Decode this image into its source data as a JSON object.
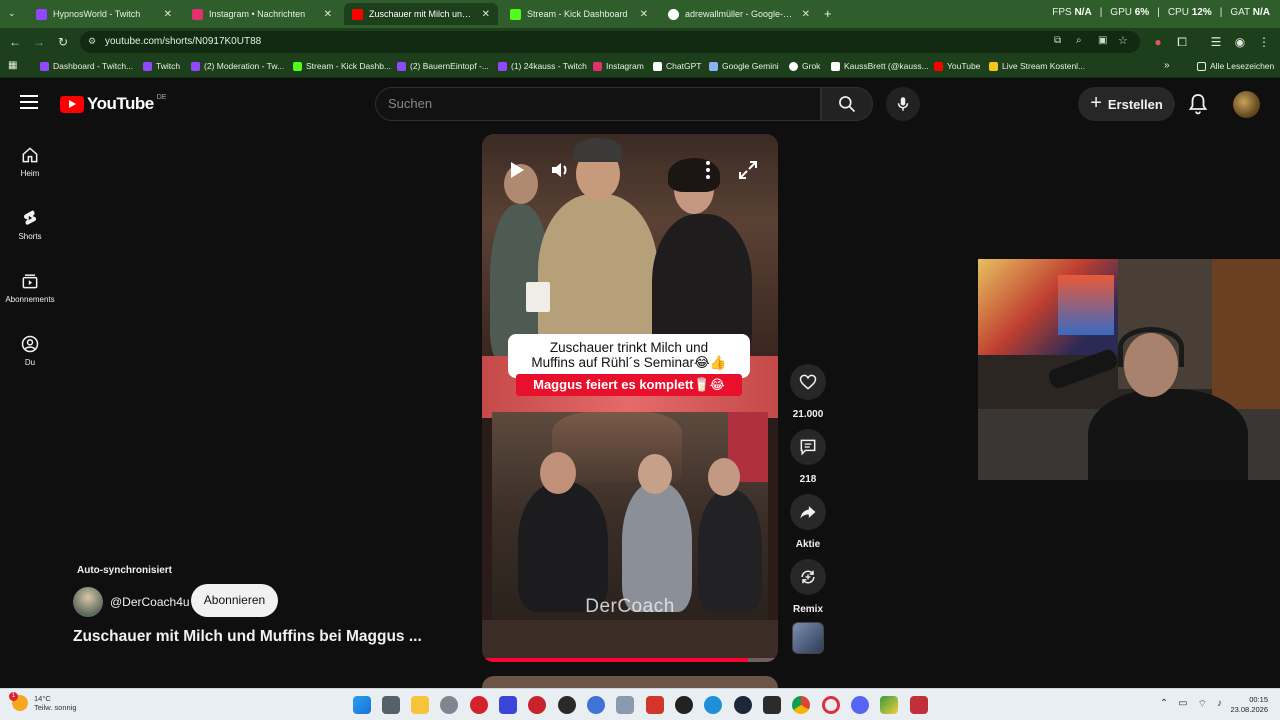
{
  "browser": {
    "tabs": [
      {
        "label": "HypnosWorld - Twitch",
        "favicon_color": "#9146ff"
      },
      {
        "label": "Instagram • Nachrichten",
        "favicon_color": "#e1306c"
      },
      {
        "label": "Zuschauer mit Milch und Muffi",
        "favicon_color": "#ff0000"
      },
      {
        "label": "Stream - Kick Dashboard",
        "favicon_color": "#53fc18"
      },
      {
        "label": "adrewallmüller - Google-Suche",
        "favicon_color": "#ffffff"
      }
    ],
    "new_tab_label": "+",
    "stats": {
      "fps_label": "FPS",
      "fps_value": "N/A",
      "gpu_label": "GPU",
      "gpu_value": "6%",
      "cpu_label": "CPU",
      "cpu_value": "12%",
      "gat_label": "GAT",
      "gat_value": "N/A"
    },
    "url": "youtube.com/shorts/N0917K0UT88",
    "bookmarks": [
      {
        "label": "Dashboard - Twitch...",
        "color": "#9146ff"
      },
      {
        "label": "Twitch",
        "color": "#9146ff"
      },
      {
        "label": "(2) Moderation - Tw...",
        "color": "#9146ff"
      },
      {
        "label": "Stream - Kick Dashb...",
        "color": "#53fc18"
      },
      {
        "label": "(2) BauernEintopf -...",
        "color": "#9146ff"
      },
      {
        "label": "(1) 24kauss - Twitch",
        "color": "#9146ff"
      },
      {
        "label": "Instagram",
        "color": "#e1306c"
      },
      {
        "label": "ChatGPT",
        "color": "#ffffff"
      },
      {
        "label": "Google Gemini",
        "color": "#8ab4f8"
      },
      {
        "label": "Grok",
        "color": "#ffffff"
      },
      {
        "label": "KaussBrett (@kauss...",
        "color": "#ffffff"
      },
      {
        "label": "YouTube",
        "color": "#ff0000"
      },
      {
        "label": "Live Stream Kostenl...",
        "color": "#f5c518"
      }
    ],
    "all_bookmarks_label": "Alle Lesezeichen"
  },
  "youtube": {
    "logo_text": "YouTube",
    "country_code": "DE",
    "search_placeholder": "Suchen",
    "create_label": "Erstellen",
    "sidebar": [
      {
        "label": "Heim",
        "icon": "home-icon"
      },
      {
        "label": "Shorts",
        "icon": "shorts-icon"
      },
      {
        "label": "Abonnements",
        "icon": "subscriptions-icon"
      },
      {
        "label": "Du",
        "icon": "you-icon"
      }
    ],
    "short": {
      "caption_line1": "Zuschauer trinkt Milch und",
      "caption_line2": "Muffins auf Rühl´s Seminar😂👍",
      "caption_red": "Maggus feiert es komplett🥛😂",
      "watermark": "DerCoach",
      "progress_fraction": 0.9
    },
    "actions": {
      "likes": "21.000",
      "comments": "218",
      "share_label": "Aktie",
      "remix_label": "Remix"
    },
    "channel": {
      "auto_sync_label": "Auto-synchronisiert",
      "handle": "@DerCoach4u",
      "subscribe_label": "Abonnieren"
    },
    "video_title": "Zuschauer mit Milch und Muffins bei Maggus ..."
  },
  "taskbar": {
    "weather_temp": "14°C",
    "weather_desc": "Teilw. sonnig",
    "weather_badge": "1",
    "time": "00:15",
    "date": "23.08.2026"
  }
}
